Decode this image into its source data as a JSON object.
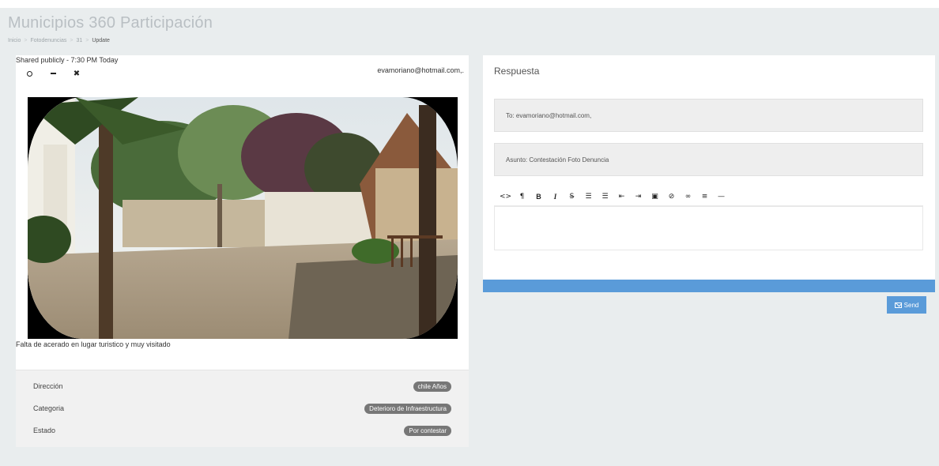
{
  "app": {
    "title": "Municipios 360 Participación"
  },
  "breadcrumb": {
    "items": [
      "Inicio",
      "Fotodenuncias",
      "31"
    ],
    "current": "Update",
    "separator": ">"
  },
  "post": {
    "shared": "Shared publicly - 7:30 PM Today",
    "email": "evamoriano@hotmail.com,.",
    "tools": [
      "circle-icon",
      "minus-icon",
      "close-icon"
    ],
    "caption": "Falta de acerado en lugar turistico y muy visitado"
  },
  "details": [
    {
      "label": "Dirección",
      "value": "chile Años"
    },
    {
      "label": "Categoria",
      "value": "Deterioro de Infraestructura"
    },
    {
      "label": "Estado",
      "value": "Por contestar"
    }
  ],
  "response": {
    "title": "Respuesta",
    "to": "To: evamoriano@hotmail.com,",
    "subject": "Asunto: Contestación Foto Denuncia",
    "toolbar": [
      {
        "name": "code-icon",
        "glyph": "<>"
      },
      {
        "name": "paragraph-icon",
        "glyph": "¶"
      },
      {
        "name": "bold-icon",
        "glyph": "B"
      },
      {
        "name": "italic-icon",
        "glyph": "I"
      },
      {
        "name": "strikethrough-icon",
        "glyph": "S̶"
      },
      {
        "name": "unordered-list-icon",
        "glyph": "☰"
      },
      {
        "name": "ordered-list-icon",
        "glyph": "☰"
      },
      {
        "name": "outdent-icon",
        "glyph": "⇤"
      },
      {
        "name": "indent-icon",
        "glyph": "⇥"
      },
      {
        "name": "image-icon",
        "glyph": "▣"
      },
      {
        "name": "video-icon",
        "glyph": "⊘"
      },
      {
        "name": "link-icon",
        "glyph": "∞"
      },
      {
        "name": "align-icon",
        "glyph": "≡"
      },
      {
        "name": "horizontal-rule-icon",
        "glyph": "—"
      }
    ],
    "send_label": "Send"
  },
  "colors": {
    "accent": "#5a9bd9",
    "pill": "#777777",
    "background": "#e9edee"
  }
}
